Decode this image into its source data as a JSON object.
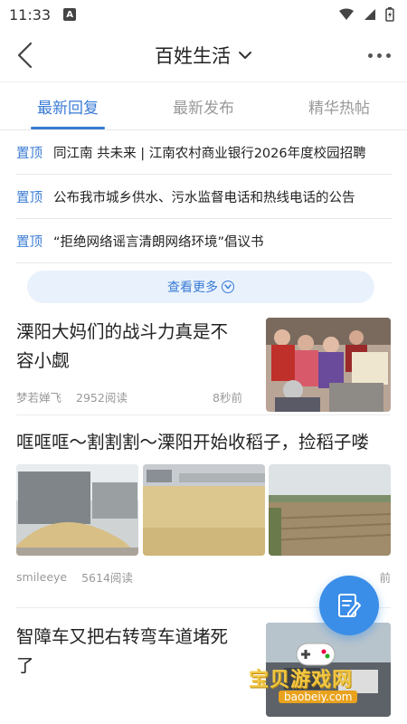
{
  "status_bar": {
    "time": "11:33"
  },
  "header": {
    "title": "百姓生活"
  },
  "tabs": [
    {
      "label": "最新回复",
      "active": true
    },
    {
      "label": "最新发布",
      "active": false
    },
    {
      "label": "精华热帖",
      "active": false
    }
  ],
  "pinned": [
    {
      "tag": "置顶",
      "text": "同江南 共未来 | 江南农村商业银行2026年度校园招聘"
    },
    {
      "tag": "置顶",
      "text": "公布我市城乡供水、污水监督电话和热线电话的公告"
    },
    {
      "tag": "置顶",
      "text": "“拒绝网络谣言清朗网络环境”倡议书"
    }
  ],
  "see_more": {
    "label": "查看更多"
  },
  "posts": [
    {
      "title": "溧阳大妈们的战斗力真是不容小觑",
      "author": "梦若婵飞",
      "reads": "2952阅读",
      "time": "8秒前"
    },
    {
      "title": "哐哐哐～割割割～溧阳开始收稻子，捡稻子喽",
      "author": "smileeye",
      "reads": "5614阅读",
      "time": "前"
    },
    {
      "title": "智障车又把右转弯车道堵死了"
    }
  ],
  "watermark": {
    "text": "宝贝游戏网",
    "url": "baobeiy.com"
  },
  "colors": {
    "accent": "#3a7bd5",
    "fab": "#3a8ee8"
  }
}
